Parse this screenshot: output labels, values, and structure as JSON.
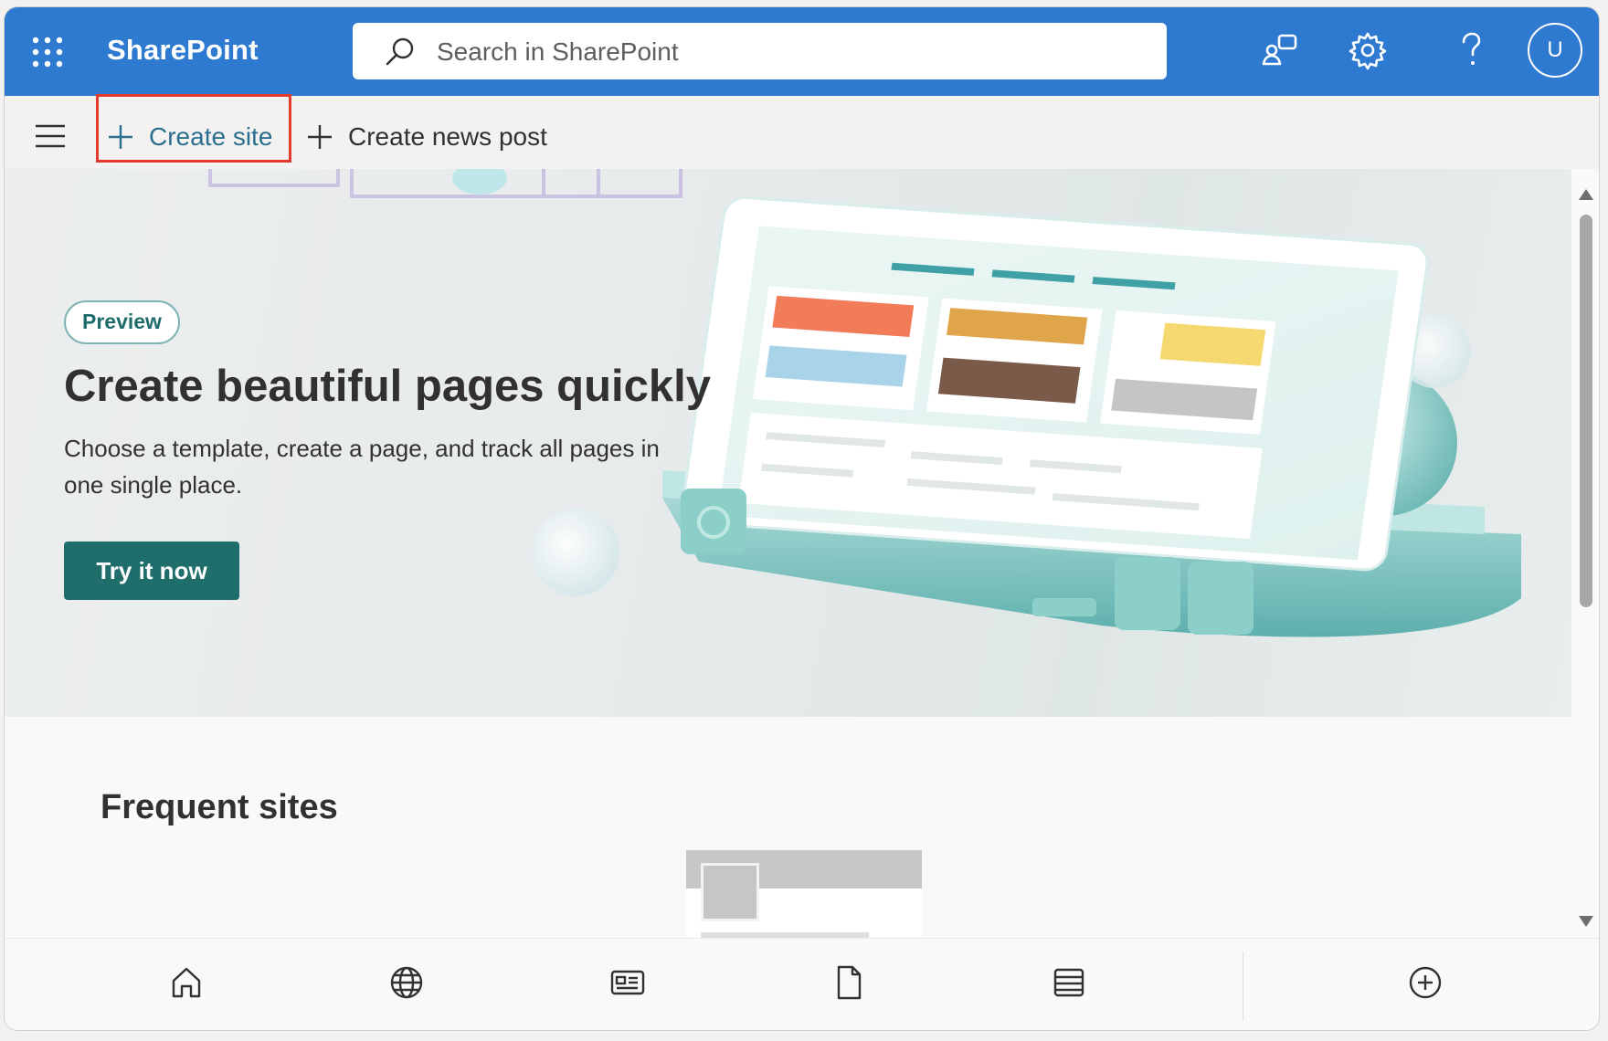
{
  "header": {
    "app_name": "SharePoint",
    "search_placeholder": "Search in SharePoint",
    "avatar_initial": "U"
  },
  "commands": {
    "create_site": "Create site",
    "create_news_post": "Create news post"
  },
  "hero": {
    "badge": "Preview",
    "title": "Create beautiful pages quickly",
    "description": "Choose a template, create a page, and track all pages in one single place.",
    "cta": "Try it now"
  },
  "frequent_sites": {
    "title": "Frequent sites"
  },
  "bottom_nav": {
    "items": [
      "home-icon",
      "globe-icon",
      "news-icon",
      "file-icon",
      "list-icon",
      "add-icon"
    ]
  },
  "colors": {
    "suite_bar": "#2f7ad1",
    "accent_teal": "#1f6e6c",
    "highlight_border": "#e23b2e"
  }
}
